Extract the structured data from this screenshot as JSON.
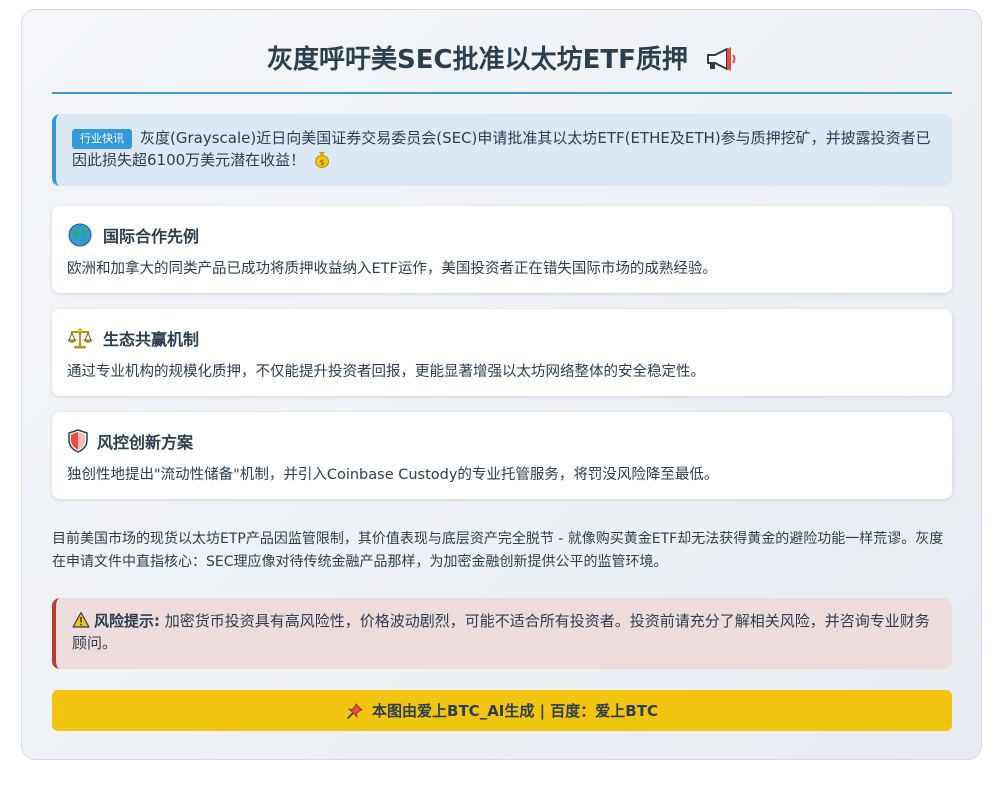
{
  "header": {
    "title": "灰度呼吁美SEC批准以太坊ETF质押",
    "title_icon": "megaphone-icon"
  },
  "news": {
    "tag": "行业快讯",
    "text": "灰度(Grayscale)近日向美国证券交易委员会(SEC)申请批准其以太坊ETF(ETHE及ETH)参与质押挖矿，并披露投资者已因此损失超6100万美元潜在收益！",
    "trailing_icon": "money-bag-icon"
  },
  "features": [
    {
      "icon": "globe-icon",
      "title": "国际合作先例",
      "desc": "欧洲和加拿大的同类产品已成功将质押收益纳入ETF运作，美国投资者正在错失国际市场的成熟经验。"
    },
    {
      "icon": "balance-scale-icon",
      "title": "生态共赢机制",
      "desc": "通过专业机构的规模化质押，不仅能提升投资者回报，更能显著增强以太坊网络整体的安全稳定性。"
    },
    {
      "icon": "shield-icon",
      "title": "风控创新方案",
      "desc": "独创性地提出\"流动性储备\"机制，并引入Coinbase Custody的专业托管服务，将罚没风险降至最低。"
    }
  ],
  "paragraph": "目前美国市场的现货以太坊ETP产品因监管限制，其价值表现与底层资产完全脱节 - 就像购买黄金ETF却无法获得黄金的避险功能一样荒谬。灰度在申请文件中直指核心：SEC理应像对待传统金融产品那样，为加密金融创新提供公平的监管环境。",
  "risk": {
    "icon": "warning-icon",
    "label": "风险提示:",
    "text": "加密货币投资具有高风险性，价格波动剧烈，可能不适合所有投资者。投资前请充分了解相关风险，并咨询专业财务顾问。"
  },
  "footer": {
    "icon": "pushpin-icon",
    "text": "本图由爱上BTC_AI生成 | 百度：爱上BTC"
  },
  "colors": {
    "accent": "#3498db",
    "danger": "#c0392b",
    "footer_bg": "#f1c40f",
    "text": "#2c3e50"
  }
}
